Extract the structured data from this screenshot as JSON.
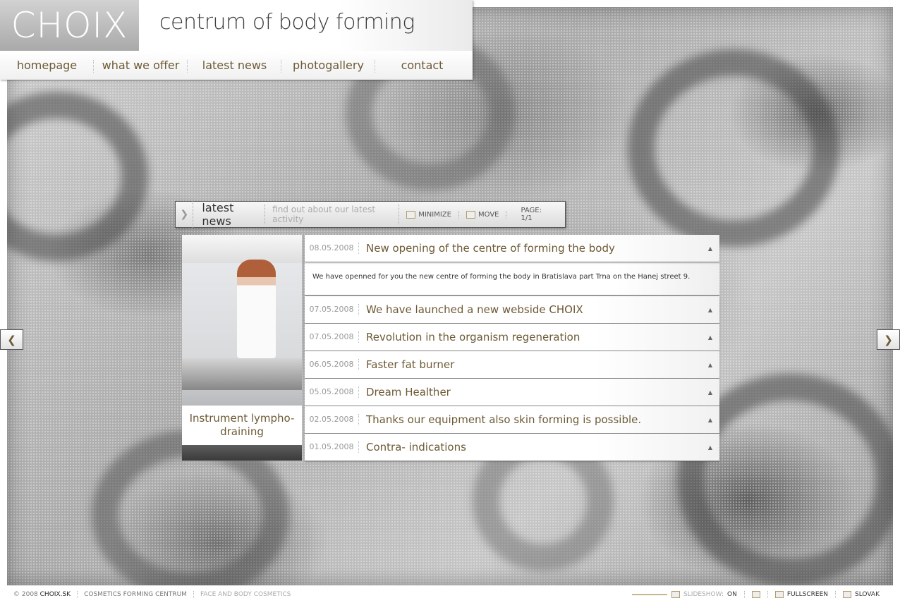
{
  "header": {
    "logo": "CHOIX",
    "tagline": "centrum of body forming"
  },
  "nav": {
    "items": [
      "homepage",
      "what we offer",
      "latest news",
      "photogallery",
      "contact"
    ]
  },
  "panel": {
    "title": "latest news",
    "subtitle": "find out about our latest activity",
    "minimize_label": "MINIMIZE",
    "move_label": "MOVE",
    "page_label": "PAGE: 1/1"
  },
  "photo": {
    "caption": "Instrument lympho-draining"
  },
  "news": [
    {
      "date": "08.05.2008",
      "title": "New opening of the centre of forming the body",
      "body": "We have openned for you the new centre of forming the body in Bratislava part Trna on the Hanej street 9."
    },
    {
      "date": "07.05.2008",
      "title": "We have launched a new webside CHOIX"
    },
    {
      "date": "07.05.2008",
      "title": "Revolution in the organism regeneration"
    },
    {
      "date": "06.05.2008",
      "title": "Faster fat burner"
    },
    {
      "date": "05.05.2008",
      "title": "Dream Healther"
    },
    {
      "date": "02.05.2008",
      "title": "Thanks our equipment also skin forming is possible."
    },
    {
      "date": "01.05.2008",
      "title": "Contra- indications"
    }
  ],
  "footer": {
    "copyright": "© 2008",
    "brand": "CHOIX.SK",
    "link1": "COSMETICS FORMING CENTRUM",
    "link2": "FACE AND BODY COSMETICS",
    "slideshow_label": "SLIDESHOW:",
    "slideshow_state": "ON",
    "fullscreen_label": "FULLSCREEN",
    "language_label": "SLOVAK"
  },
  "colors": {
    "accent": "#6d5a35",
    "background": "#bdbdbd"
  }
}
